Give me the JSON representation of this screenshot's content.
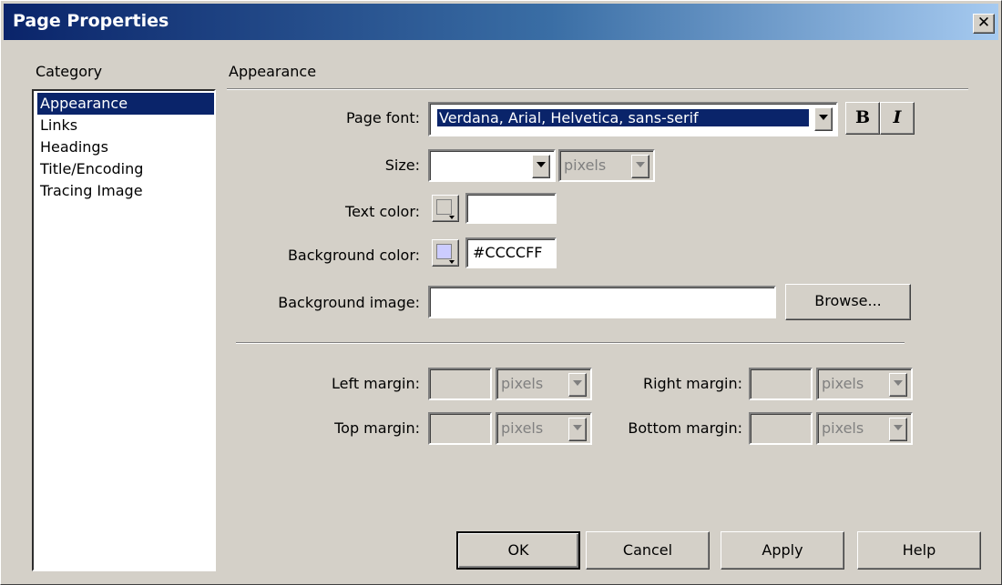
{
  "dialog": {
    "title": "Page Properties",
    "close_glyph": "✕"
  },
  "category": {
    "label": "Category",
    "items": [
      "Appearance",
      "Links",
      "Headings",
      "Title/Encoding",
      "Tracing Image"
    ],
    "selected": "Appearance"
  },
  "section_title": "Appearance",
  "page_font": {
    "label": "Page font:",
    "value": "Verdana, Arial, Helvetica, sans-serif",
    "bold_label": "B",
    "italic_label": "I"
  },
  "size": {
    "label": "Size:",
    "value": "",
    "unit": "pixels"
  },
  "text_color": {
    "label": "Text color:",
    "value": "",
    "swatch": "#d4d0c8"
  },
  "background_color": {
    "label": "Background color:",
    "value": "#CCCCFF",
    "swatch": "#CCCCFF"
  },
  "background_image": {
    "label": "Background image:",
    "value": "",
    "browse_label": "Browse..."
  },
  "margins": {
    "left_label": "Left margin:",
    "right_label": "Right margin:",
    "top_label": "Top margin:",
    "bottom_label": "Bottom margin:",
    "unit": "pixels"
  },
  "buttons": {
    "ok": "OK",
    "cancel": "Cancel",
    "apply": "Apply",
    "help": "Help"
  },
  "colors": {
    "dialog_bg": "#d4d0c8",
    "selection": "#0a246a",
    "title_gradient_start": "#0a246a",
    "title_gradient_end": "#a6caf0"
  }
}
